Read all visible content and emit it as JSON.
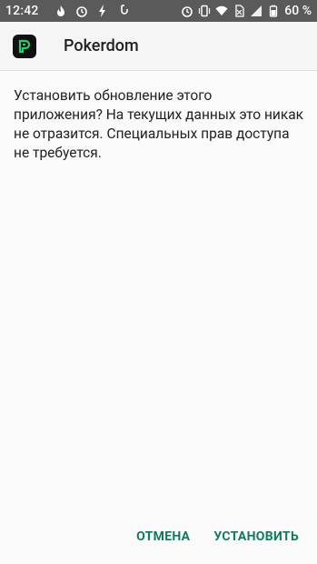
{
  "status_bar": {
    "time": "12:42",
    "battery_percent": "60 %",
    "left_icons": [
      "flame-icon",
      "alarm-icon",
      "bolt-icon",
      "hook-icon"
    ],
    "right_icons": [
      "alarm-icon",
      "vibrate-icon",
      "wifi-icon",
      "no-sim-icon",
      "signal-icon",
      "battery-icon"
    ]
  },
  "header": {
    "app_name": "Pokerdom",
    "logo_icon": "pokerdom-logo-icon",
    "logo_color": "#24d06b"
  },
  "dialog": {
    "message": "Установить обновление этого приложения? На текущих данных это никак не отразится. Специальных прав доступа не требуется."
  },
  "actions": {
    "cancel_label": "ОТМЕНА",
    "install_label": "УСТАНОВИТЬ",
    "accent_color": "#0f7b5e"
  }
}
